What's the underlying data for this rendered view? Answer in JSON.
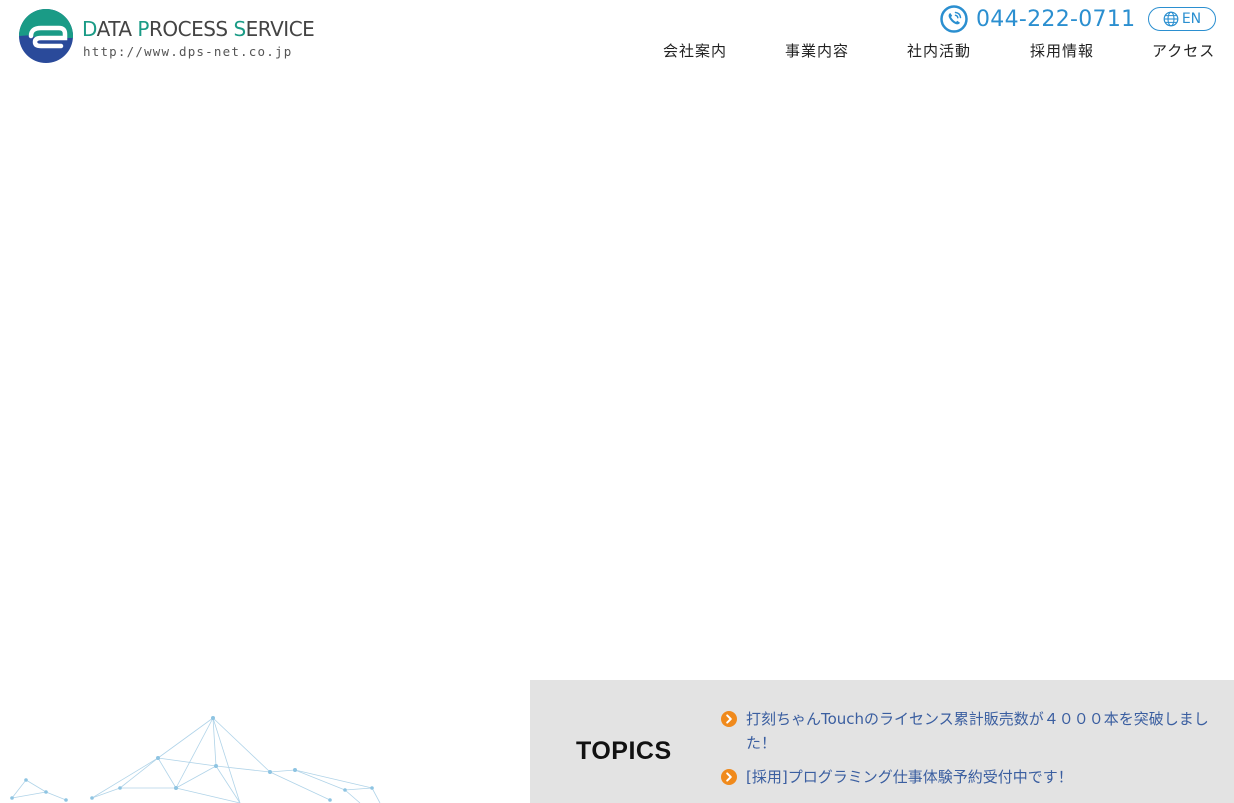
{
  "header": {
    "logo": {
      "name_first": "D",
      "name_rest_1": "ATA ",
      "name_p": "P",
      "name_rest_2": "ROCESS ",
      "name_s": "S",
      "name_rest_3": "ERVICE",
      "url": "http://www.dps-net.co.jp"
    },
    "phone": "044-222-0711",
    "language_button": "EN",
    "nav": [
      {
        "label": "会社案内"
      },
      {
        "label": "事業内容"
      },
      {
        "label": "社内活動"
      },
      {
        "label": "採用情報"
      },
      {
        "label": "アクセス"
      }
    ]
  },
  "topics": {
    "title": "TOPICS",
    "items": [
      {
        "text": "打刻ちゃんTouchのライセンス累計販売数が４０００本を突破しました！"
      },
      {
        "text": "[採用]プログラミング仕事体験予約受付中です！"
      }
    ]
  },
  "colors": {
    "brand_teal": "#1a9b86",
    "brand_navy": "#2a4a9a",
    "link_blue": "#2b8fd0",
    "topic_bullet": "#f08a1c",
    "topics_background": "#e3e3e3"
  }
}
